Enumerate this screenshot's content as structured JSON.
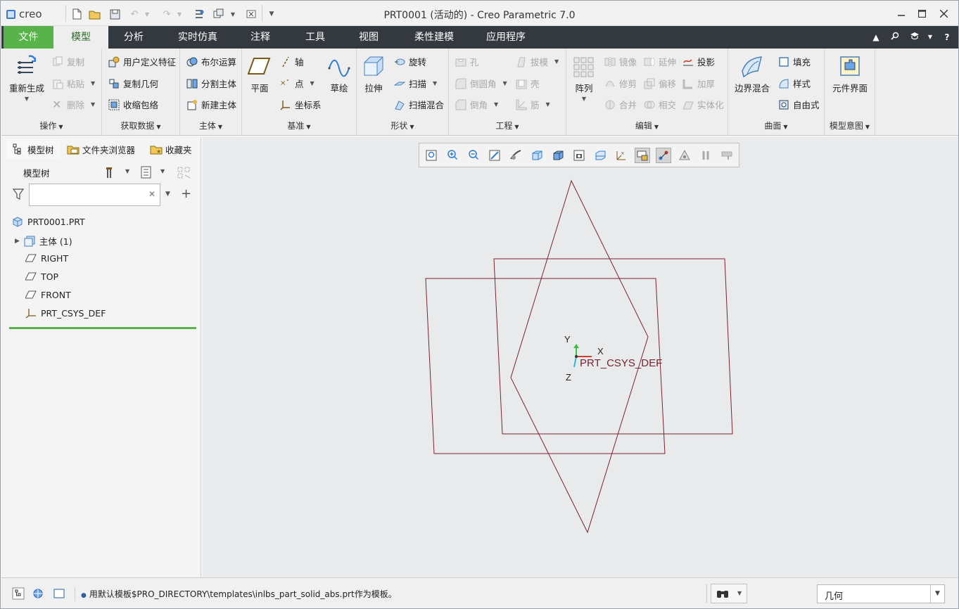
{
  "app": {
    "logo_text": "creo",
    "window_title": "PRT0001 (活动的) - Creo Parametric 7.0"
  },
  "ribbon_tabs": [
    "文件",
    "模型",
    "分析",
    "实时仿真",
    "注释",
    "工具",
    "视图",
    "柔性建模",
    "应用程序"
  ],
  "ribbon": {
    "operations": {
      "label": "操作",
      "regenerate": "重新生成",
      "copy": "复制",
      "paste": "粘贴",
      "delete": "删除"
    },
    "get_data": {
      "label": "获取数据",
      "udf": "用户定义特征",
      "copy_geom": "复制几何",
      "shrinkwrap": "收缩包络"
    },
    "body": {
      "label": "主体",
      "boolean": "布尔运算",
      "split": "分割主体",
      "new": "新建主体"
    },
    "datum": {
      "label": "基准",
      "plane": "平面",
      "axis": "轴",
      "point": "点",
      "csys": "坐标系",
      "sketch": "草绘"
    },
    "shapes": {
      "label": "形状",
      "extrude": "拉伸",
      "revolve": "旋转",
      "sweep": "扫描",
      "swept_blend": "扫描混合"
    },
    "engineering": {
      "label": "工程",
      "hole": "孔",
      "round": "倒圆角",
      "chamfer": "倒角",
      "draft": "拔模",
      "shell": "壳",
      "rib": "筋"
    },
    "editing": {
      "label": "编辑",
      "pattern": "阵列",
      "mirror": "镜像",
      "trim": "修剪",
      "merge": "合并",
      "extend": "延伸",
      "offset": "偏移",
      "intersect": "相交",
      "project": "投影",
      "thicken": "加厚",
      "solidify": "实体化"
    },
    "surfaces": {
      "label": "曲面",
      "boundary_blend": "边界混合",
      "fill": "填充",
      "style": "样式",
      "freestyle": "自由式"
    },
    "model_intent": {
      "label": "模型意图",
      "component_interface": "元件界面"
    }
  },
  "left_panel": {
    "tabs": [
      "模型树",
      "文件夹浏览器",
      "收藏夹"
    ],
    "header": "模型树",
    "search_value": "",
    "tree": {
      "root": "PRT0001.PRT",
      "items": [
        "主体 (1)",
        "RIGHT",
        "TOP",
        "FRONT",
        "PRT_CSYS_DEF"
      ]
    }
  },
  "viewport": {
    "csys_label": "PRT_CSYS_DEF",
    "axis_x": "X",
    "axis_y": "Y",
    "axis_z": "Z",
    "datum_color": "#7a2330"
  },
  "status": {
    "message": "用默认模板$PRO_DIRECTORY\\templates\\inlbs_part_solid_abs.prt作为模板。",
    "filter_value": "几何"
  },
  "colors": {
    "file_tab": "#58b44a",
    "tab_bar": "#33393f",
    "active_tab_text": "#2d6b28",
    "tree_underline": "#58b44a"
  }
}
